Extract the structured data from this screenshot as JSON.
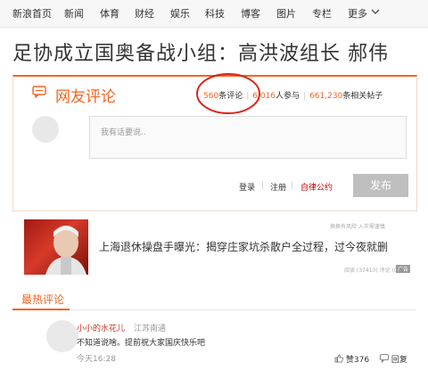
{
  "nav": {
    "items": [
      "新浪首页",
      "新闻",
      "体育",
      "财经",
      "娱乐",
      "科技",
      "博客",
      "图片",
      "专栏",
      "更多"
    ],
    "chevron_icon": "chevron-down-icon"
  },
  "headline": "足协成立国奥备战小组：高洪波组长 郝伟",
  "comments": {
    "title": "网友评论",
    "stats": {
      "count": "560",
      "count_unit": "条评论",
      "participants": "6,016",
      "participants_unit": "人参与",
      "posts": "661,230",
      "posts_unit": "条相关帖子"
    },
    "input_placeholder": "我有话要说..",
    "login": "登录",
    "divider": "|",
    "register": "注册",
    "convention": "自律公约",
    "publish": "发布"
  },
  "ad": {
    "meta": "换换有风险 入市需谨慎",
    "headline": "上海退休操盘手曝光：揭穿庄家坑杀散户全过程，过今夜就删",
    "footer": "阅读 (37410) 评论 (0)",
    "badge": "广告"
  },
  "hottest": {
    "title": "最热评论",
    "items": [
      {
        "user": "小小的水花儿",
        "location": "江苏南通",
        "text": "不知道说啥。提前祝大家国庆快乐吧",
        "time": "今天16:28",
        "likes": "赞376",
        "reply": "回复"
      }
    ]
  },
  "colors": {
    "accent": "#f26522",
    "annotation": "#d9261c",
    "convention": "#cc0000"
  }
}
